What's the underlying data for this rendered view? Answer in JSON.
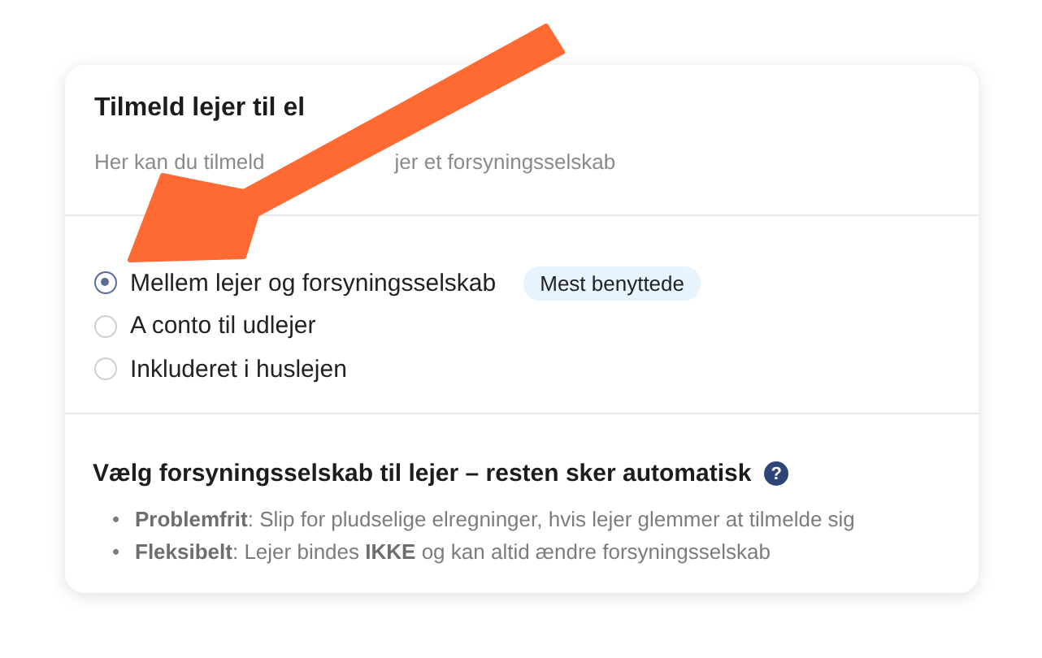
{
  "card": {
    "title": "Tilmeld lejer til el",
    "subtitle_parts": [
      "Her kan du tilmeld",
      "jer et forsyningsselskab"
    ]
  },
  "options": [
    {
      "label": "Mellem lejer og forsyningsselskab",
      "selected": true,
      "badge": "Mest benyttede"
    },
    {
      "label": "A conto til udlejer",
      "selected": false
    },
    {
      "label": "Inkluderet i huslejen",
      "selected": false
    }
  ],
  "info": {
    "heading": "Vælg forsyningsselskab til lejer – resten sker automatisk",
    "help_icon": "?",
    "bullets": [
      {
        "marker": "•",
        "text": "**Problemfrit**: Slip for pludselige elregninger, hvis lejer glemmer at tilmelde sig"
      },
      {
        "marker": "•",
        "text": "**Fleksibelt**: Lejer bindes **IKKE** og kan altid ændre forsyningsselskab"
      }
    ]
  }
}
